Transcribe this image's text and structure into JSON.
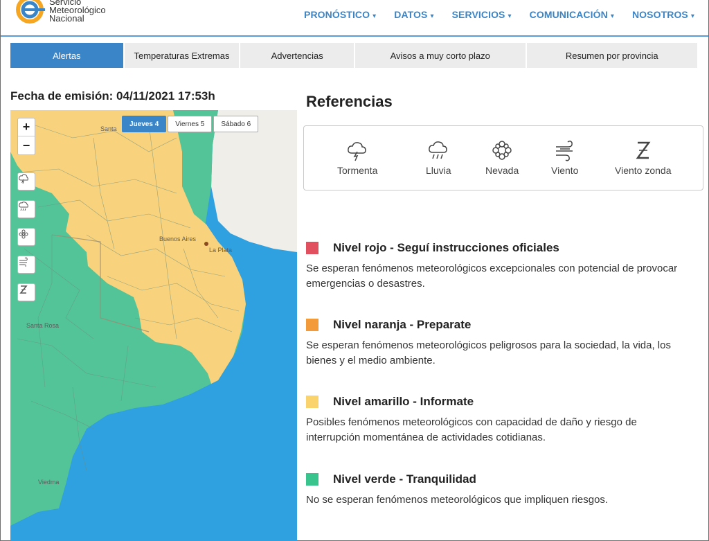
{
  "brand": {
    "line1": "Servicio",
    "line2": "Meteorológico",
    "line3": "Nacional"
  },
  "nav": [
    {
      "label": "PRONÓSTICO"
    },
    {
      "label": "DATOS"
    },
    {
      "label": "SERVICIOS"
    },
    {
      "label": "COMUNICACIÓN"
    },
    {
      "label": "NOSOTROS"
    }
  ],
  "tabs": [
    {
      "label": "Alertas",
      "active": true
    },
    {
      "label": "Temperaturas Extremas"
    },
    {
      "label": "Advertencias"
    },
    {
      "label": "Avisos a muy corto plazo"
    },
    {
      "label": "Resumen por provincia"
    }
  ],
  "emission": "Fecha de emisión: 04/11/2021 17:53h",
  "map": {
    "zoom_in": "+",
    "zoom_out": "−",
    "days": [
      {
        "label": "Jueves 4",
        "active": true
      },
      {
        "label": "Viernes 5"
      },
      {
        "label": "Sábado 6"
      }
    ],
    "tools": [
      "storm-icon",
      "rain-icon",
      "snow-icon",
      "wind-icon",
      "zonda-icon"
    ],
    "places": {
      "santa_fe": "Santa",
      "buenos_aires": "Buenos Aires",
      "la_plata": "La Plata",
      "santa_rosa": "Santa Rosa",
      "viedma": "Viedma"
    }
  },
  "references": {
    "title": "Referencias",
    "items": [
      {
        "label": "Tormenta",
        "icon": "storm-icon"
      },
      {
        "label": "Lluvia",
        "icon": "rain-icon"
      },
      {
        "label": "Nevada",
        "icon": "snow-icon"
      },
      {
        "label": "Viento",
        "icon": "wind-icon"
      },
      {
        "label": "Viento zonda",
        "icon": "zonda-icon"
      }
    ]
  },
  "levels": [
    {
      "title": "Nivel rojo - Seguí instrucciones oficiales",
      "color": "#e0505f",
      "desc": "Se esperan fenómenos meteorológicos excepcionales con potencial de provocar emergencias o desastres."
    },
    {
      "title": "Nivel naranja - Preparate",
      "color": "#f39a3b",
      "desc": "Se esperan fenómenos meteorológicos peligrosos para la sociedad, la vida, los bienes y el medio ambiente."
    },
    {
      "title": "Nivel amarillo - Informate",
      "color": "#fbd36c",
      "desc": "Posibles fenómenos meteorológicos con capacidad de daño y riesgo de interrupción momentánea de actividades cotidianas."
    },
    {
      "title": "Nivel verde - Tranquilidad",
      "color": "#39c48e",
      "desc": "No se esperan fenómenos meteorológicos que impliquen riesgos."
    }
  ],
  "colors": {
    "accent": "#3a85c7",
    "map_yellow": "#f8d27c",
    "map_green": "#52c498",
    "map_sea": "#2fa0e0",
    "map_land_other": "#f0efe9"
  }
}
